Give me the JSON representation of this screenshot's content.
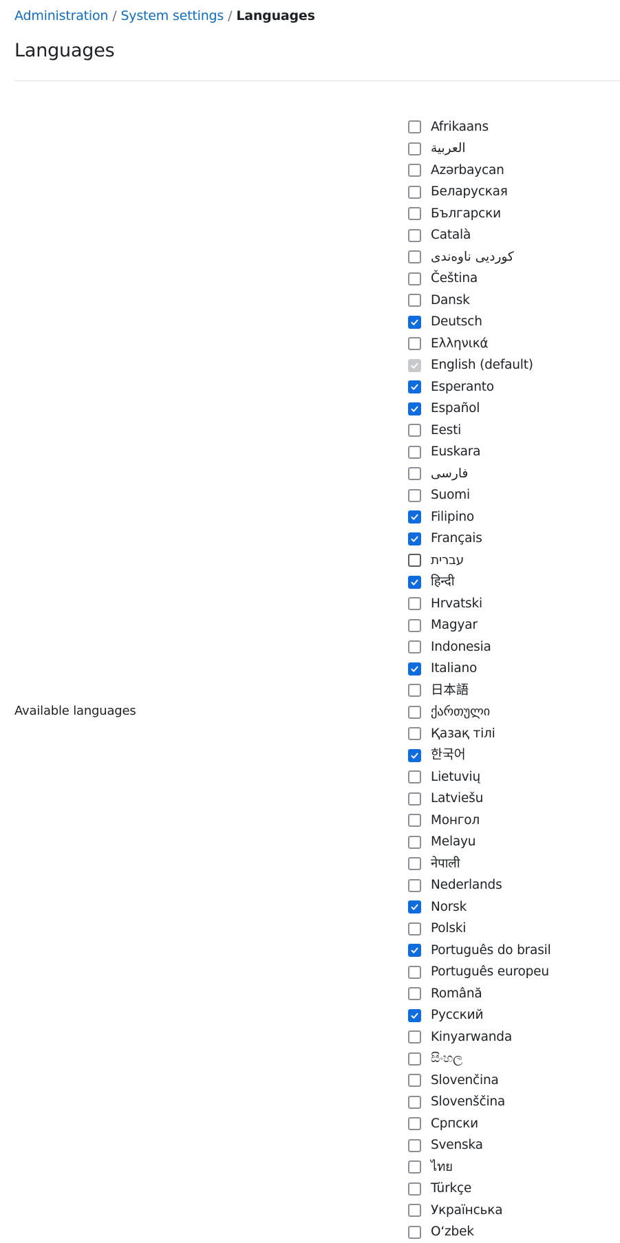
{
  "breadcrumb": {
    "items": [
      "Administration",
      "System settings"
    ],
    "separator": "/",
    "current": "Languages"
  },
  "page": {
    "title": "Languages"
  },
  "setting": {
    "label": "Available languages"
  },
  "colors": {
    "link": "#0f6cbf",
    "checked": "#0f6cdf",
    "disabled": "#c8c9cc",
    "unchecked_border": "#8f8d9a"
  },
  "languages": [
    {
      "label": "Afrikaans",
      "checked": false
    },
    {
      "label": "العربية",
      "checked": false
    },
    {
      "label": "Azərbaycan",
      "checked": false
    },
    {
      "label": "Беларуская",
      "checked": false
    },
    {
      "label": "Български",
      "checked": false
    },
    {
      "label": "Català",
      "checked": false
    },
    {
      "label": "کوردیی ناوەندی",
      "checked": false
    },
    {
      "label": "Čeština",
      "checked": false
    },
    {
      "label": "Dansk",
      "checked": false
    },
    {
      "label": "Deutsch",
      "checked": true
    },
    {
      "label": "Ελληνικά",
      "checked": false
    },
    {
      "label": "English (default)",
      "checked": true,
      "disabled": true
    },
    {
      "label": "Esperanto",
      "checked": true
    },
    {
      "label": "Español",
      "checked": true
    },
    {
      "label": "Eesti",
      "checked": false
    },
    {
      "label": "Euskara",
      "checked": false
    },
    {
      "label": "فارسی",
      "checked": false
    },
    {
      "label": "Suomi",
      "checked": false
    },
    {
      "label": "Filipino",
      "checked": true
    },
    {
      "label": "Français",
      "checked": true
    },
    {
      "label": "עברית",
      "checked": false,
      "focused": true
    },
    {
      "label": "हिन्दी",
      "checked": true
    },
    {
      "label": "Hrvatski",
      "checked": false
    },
    {
      "label": "Magyar",
      "checked": false
    },
    {
      "label": "Indonesia",
      "checked": false
    },
    {
      "label": "Italiano",
      "checked": true
    },
    {
      "label": "日本語",
      "checked": false
    },
    {
      "label": "ქართული",
      "checked": false
    },
    {
      "label": "Қазақ тілі",
      "checked": false
    },
    {
      "label": "한국어",
      "checked": true
    },
    {
      "label": "Lietuvių",
      "checked": false
    },
    {
      "label": "Latviešu",
      "checked": false
    },
    {
      "label": "Монгол",
      "checked": false
    },
    {
      "label": "Melayu",
      "checked": false
    },
    {
      "label": "नेपाली",
      "checked": false
    },
    {
      "label": "Nederlands",
      "checked": false
    },
    {
      "label": "Norsk",
      "checked": true
    },
    {
      "label": "Polski",
      "checked": false
    },
    {
      "label": "Português do brasil",
      "checked": true
    },
    {
      "label": "Português europeu",
      "checked": false
    },
    {
      "label": "Română",
      "checked": false
    },
    {
      "label": "Русский",
      "checked": true
    },
    {
      "label": "Kinyarwanda",
      "checked": false
    },
    {
      "label": "සිංහල",
      "checked": false
    },
    {
      "label": "Slovenčina",
      "checked": false
    },
    {
      "label": "Slovenščina",
      "checked": false
    },
    {
      "label": "Српски",
      "checked": false
    },
    {
      "label": "Svenska",
      "checked": false
    },
    {
      "label": "ไทย",
      "checked": false
    },
    {
      "label": "Türkçe",
      "checked": false
    },
    {
      "label": "Українська",
      "checked": false
    },
    {
      "label": "O‘zbek",
      "checked": false
    }
  ]
}
